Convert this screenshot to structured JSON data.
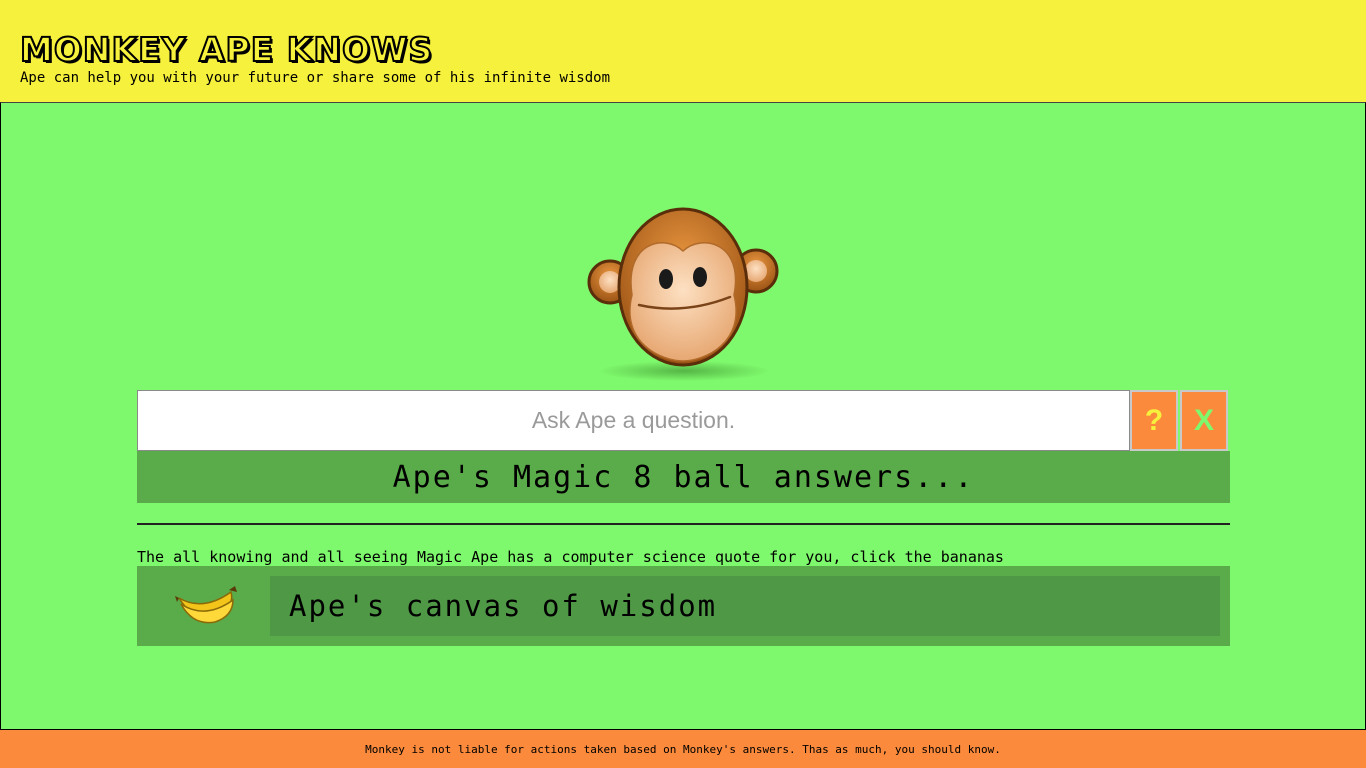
{
  "header": {
    "title": "MONKEY APE KNOWS",
    "subtitle": "Ape can help you with your future or share some of his infinite wisdom"
  },
  "ask": {
    "placeholder": "Ask Ape a question.",
    "ask_label": "?",
    "clear_label": "X"
  },
  "answer": {
    "text": "Ape's Magic 8 ball answers..."
  },
  "quote": {
    "intro": "The all knowing and all seeing Magic Ape has a computer science quote for you, click the bananas",
    "canvas_text": "Ape's canvas of wisdom",
    "banana_icon": "banana-icon"
  },
  "footer": {
    "text": "Monkey is not liable for actions taken based on Monkey's answers. Thas as much, you should know."
  },
  "colors": {
    "header_bg": "#f6f13c",
    "main_bg": "#7ef86c",
    "accent_orange": "#fb8a3c",
    "panel_green": "#5aab4a",
    "canvas_green": "#4f9846"
  }
}
